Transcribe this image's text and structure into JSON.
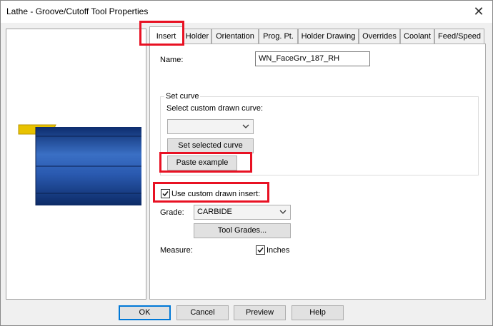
{
  "window": {
    "title": "Lathe - Groove/Cutoff Tool Properties",
    "close_glyph": "✕"
  },
  "tabs": [
    {
      "label": "Insert",
      "active": true
    },
    {
      "label": "Holder"
    },
    {
      "label": "Orientation"
    },
    {
      "label": "Prog. Pt."
    },
    {
      "label": "Holder Drawing"
    },
    {
      "label": "Overrides"
    },
    {
      "label": "Coolant"
    },
    {
      "label": "Feed/Speed"
    }
  ],
  "insert": {
    "name_label": "Name:",
    "name_value": "WN_FaceGrv_187_RH",
    "set_curve": {
      "legend": "Set curve",
      "select_label": "Select custom drawn curve:",
      "combo_value": "",
      "set_selected_button": "Set selected curve",
      "paste_example_button": "Paste example"
    },
    "use_custom_insert": {
      "label": "Use custom drawn insert:",
      "checked": true
    },
    "grade_label": "Grade:",
    "grade_value": "CARBIDE",
    "tool_grades_button": "Tool Grades...",
    "measure_label": "Measure:",
    "inches": {
      "label": "Inches",
      "checked": true
    }
  },
  "footer": {
    "ok": "OK",
    "cancel": "Cancel",
    "preview": "Preview",
    "help": "Help"
  },
  "colors": {
    "highlight": "#e81123",
    "insert_gold": "#e8c200",
    "holder_blue": "#1f4fa0",
    "default_button_border": "#0078d7"
  },
  "icons": {
    "close": "close-icon",
    "dropdown": "chevron-down-icon",
    "check": "checkmark-icon"
  }
}
